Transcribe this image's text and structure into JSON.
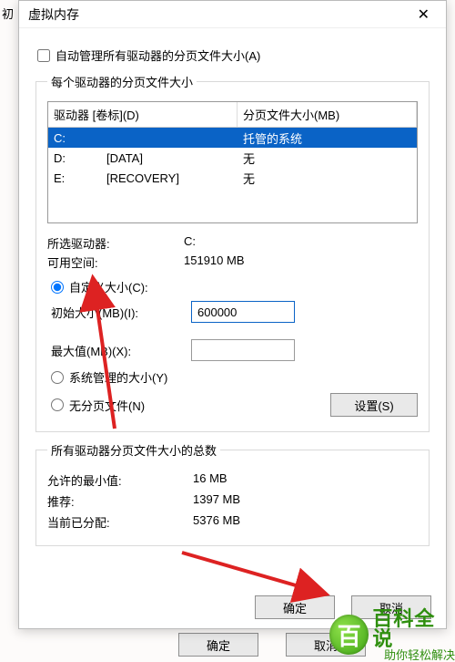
{
  "bg_fragment": "初           ",
  "window": {
    "title": "虚拟内存",
    "close": "✕"
  },
  "auto_manage": {
    "checked": false,
    "label": "自动管理所有驱动器的分页文件大小(A)"
  },
  "drives_group": "每个驱动器的分页文件大小",
  "list": {
    "head_drive": "驱动器 [卷标](D)",
    "head_size": "分页文件大小(MB)",
    "rows": [
      {
        "drive": "C:",
        "label": "",
        "size": "托管的系统",
        "selected": true
      },
      {
        "drive": "D:",
        "label": "[DATA]",
        "size": "无",
        "selected": false
      },
      {
        "drive": "E:",
        "label": "[RECOVERY]",
        "size": "无",
        "selected": false
      }
    ]
  },
  "selected": {
    "drive_label": "所选驱动器:",
    "drive_value": "C:",
    "free_label": "可用空间:",
    "free_value": "151910 MB"
  },
  "size_mode": {
    "custom_label": "自定义大小(C):",
    "initial_label": "初始大小(MB)(I):",
    "initial_value": "600000",
    "max_label": "最大值(MB)(X):",
    "max_value": "",
    "system_label": "系统管理的大小(Y)",
    "none_label": "无分页文件(N)",
    "selected": "custom"
  },
  "set_button": "设置(S)",
  "totals_group": "所有驱动器分页文件大小的总数",
  "totals": {
    "min_label": "允许的最小值:",
    "min_value": "16 MB",
    "rec_label": "推荐:",
    "rec_value": "1397 MB",
    "cur_label": "当前已分配:",
    "cur_value": "5376 MB"
  },
  "ok_button": "确定",
  "cancel_button": "取消",
  "outer_ok": "确定",
  "outer_cancel": "取消",
  "watermark": {
    "badge": "百",
    "big": "百科全说",
    "small": "助你轻松解决"
  }
}
